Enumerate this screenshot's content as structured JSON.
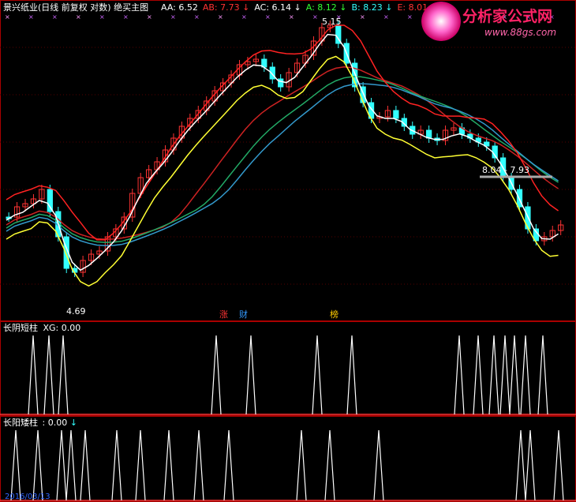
{
  "header": {
    "title": "景兴纸业(日线 前复权 对数) 绝买主图",
    "items": [
      {
        "label": "AA: 6.52",
        "arrow": "",
        "color": "#ffffff"
      },
      {
        "label": "AB: 7.73",
        "arrow": "↓",
        "color": "#ff3333"
      },
      {
        "label": "AC: 6.14",
        "arrow": "↓",
        "color": "#ffffff"
      },
      {
        "label": "A: 8.12",
        "arrow": "↓",
        "color": "#33ff33"
      },
      {
        "label": "B: 8.23",
        "arrow": "↓",
        "color": "#33ffff"
      },
      {
        "label": "E: 8.01",
        "arrow": "↓",
        "color": "#ff3333"
      }
    ]
  },
  "watermark": {
    "name": "分析家公式网",
    "url": "www.88gs.com"
  },
  "annotations": {
    "high": "5.15",
    "low": "4.69",
    "range": "8.04 - 7.93"
  },
  "markers": [
    {
      "text": "涨",
      "color": "#ff3333"
    },
    {
      "text": "财",
      "color": "#3399ff"
    },
    {
      "text": "榜",
      "color": "#ffcc00"
    }
  ],
  "panel2": {
    "title": "长阴短柱",
    "value": "XG: 0.00"
  },
  "panel3": {
    "title": "长阳矮柱",
    "value": ": 0.00",
    "arrow": "↓"
  },
  "footer": {
    "date": "2016/03/13"
  },
  "colors": {
    "up": "#ff3333",
    "down": "#33ffff",
    "yellow": "#ffff33",
    "white": "#ffffff",
    "grid": "#880000"
  }
}
